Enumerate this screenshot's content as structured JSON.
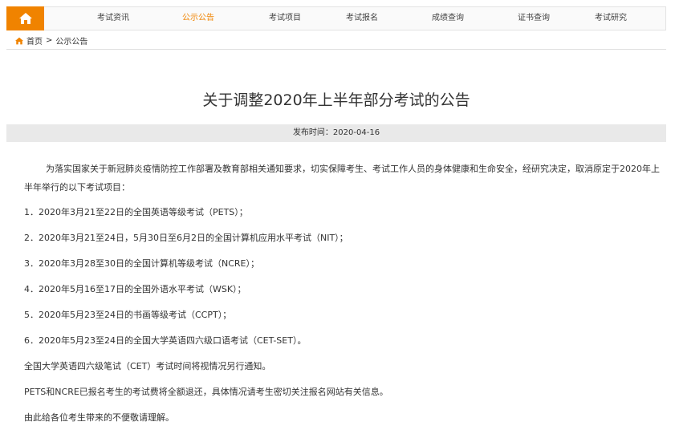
{
  "nav": {
    "items": [
      {
        "label": "考试资讯"
      },
      {
        "label": "公示公告",
        "active": true
      },
      {
        "label": "考试项目"
      },
      {
        "label": "考试报名"
      },
      {
        "label": "成绩查询"
      },
      {
        "label": "证书查询"
      },
      {
        "label": "考试研究"
      }
    ],
    "home_icon": "home-icon"
  },
  "breadcrumb": {
    "home": "首页",
    "separator": ">",
    "current": "公示公告"
  },
  "article": {
    "title": "关于调整2020年上半年部分考试的公告",
    "publish": "发布时间：2020-04-16",
    "intro": "为落实国家关于新冠肺炎疫情防控工作部署及教育部相关通知要求，切实保障考生、考试工作人员的身体健康和生命安全，经研究决定，取消原定于2020年上半年举行的以下考试项目：",
    "items": [
      "1．2020年3月21至22日的全国英语等级考试（PETS）；",
      "2．2020年3月21至24日，5月30日至6月2日的全国计算机应用水平考试（NIT）；",
      "3．2020年3月28至30日的全国计算机等级考试（NCRE）；",
      "4．2020年5月16至17日的全国外语水平考试（WSK）；",
      "5．2020年5月23至24日的书画等级考试（CCPT）；",
      "6．2020年5月23至24日的全国大学英语四六级口语考试（CET-SET）。"
    ],
    "notes": [
      "全国大学英语四六级笔试（CET）考试时间将视情况另行通知。",
      "PETS和NCRE已报名考生的考试费将全额退还，具体情况请考生密切关注报名网站有关信息。",
      "由此给各位考生带来的不便敬请理解。"
    ]
  },
  "colors": {
    "accent": "#f08300",
    "nav_bg": "#fafafa",
    "pubbar_bg": "#e9e9e9"
  }
}
